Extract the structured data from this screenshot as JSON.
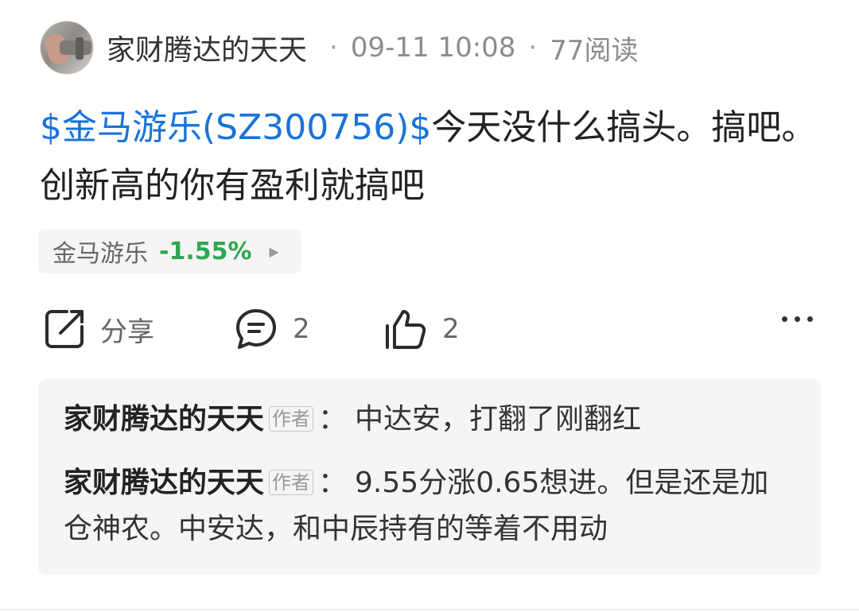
{
  "post": {
    "author": "家财腾达的天天",
    "time": "09-11 10:08",
    "views": "77阅读",
    "stock_link": "$金马游乐(SZ300756)$",
    "content": "今天没什么搞头。搞吧。创新高的你有盈利就搞吧",
    "avatar_icon": "user-avatar-photo"
  },
  "stock_chip": {
    "name": "金马游乐",
    "change": "-1.55%",
    "change_color": "#2fa84f",
    "arrow_icon": "play-right-icon"
  },
  "actions": {
    "share_label": "分享",
    "comment_count": "2",
    "like_count": "2"
  },
  "comments": [
    {
      "author": "家财腾达的天天",
      "tag": "作者",
      "sep": "：",
      "text": "中达安，打翻了刚翻红"
    },
    {
      "author": "家财腾达的天天",
      "tag": "作者",
      "sep": "：",
      "text": "9.55分涨0.65想进。但是还是加仓神农。中安达，和中辰持有的等着不用动"
    }
  ],
  "colors": {
    "link": "#1a73d9",
    "down": "#2fa84f",
    "panel": "#f5f5f6"
  }
}
